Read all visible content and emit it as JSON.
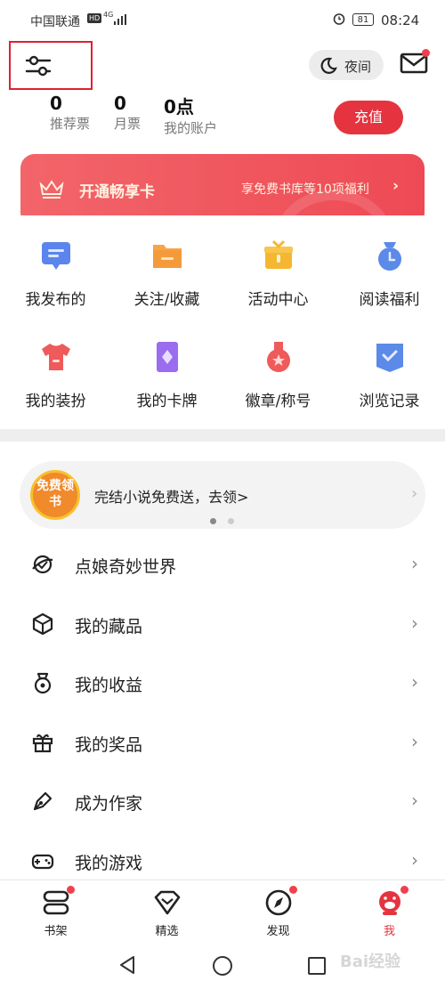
{
  "status_bar": {
    "carrier": "中国联通",
    "hd": "HD",
    "network": "4G",
    "battery": "81",
    "time": "08:24"
  },
  "header": {
    "night_label": "夜间"
  },
  "account": {
    "items": [
      {
        "value": "0",
        "label": "推荐票"
      },
      {
        "value": "0",
        "label": "月票"
      },
      {
        "value": "0点",
        "label": "我的账户"
      }
    ],
    "recharge_label": "充值"
  },
  "vip": {
    "title": "开通畅享卡",
    "benefit": "享免费书库等10项福利"
  },
  "grid": {
    "row1": [
      {
        "label": "我发布的",
        "icon": "chat-icon",
        "color": "#4f7fe8"
      },
      {
        "label": "关注/收藏",
        "icon": "folder-icon",
        "color": "#f59a3a"
      },
      {
        "label": "活动中心",
        "icon": "gift-box-icon",
        "color": "#f5b731"
      },
      {
        "label": "阅读福利",
        "icon": "clock-bag-icon",
        "color": "#5b8ae8"
      }
    ],
    "row2": [
      {
        "label": "我的装扮",
        "icon": "tshirt-icon",
        "color": "#ef5a5a"
      },
      {
        "label": "我的卡牌",
        "icon": "card-icon",
        "color": "#9a6cf0"
      },
      {
        "label": "徽章/称号",
        "icon": "medal-icon",
        "color": "#ef5a5a"
      },
      {
        "label": "浏览记录",
        "icon": "history-icon",
        "color": "#5b8ae8"
      }
    ]
  },
  "promo": {
    "badge": "免费领书",
    "text": "完结小说免费送，去领>"
  },
  "menu": [
    {
      "label": "点娘奇妙世界"
    },
    {
      "label": "我的藏品"
    },
    {
      "label": "我的收益"
    },
    {
      "label": "我的奖品"
    },
    {
      "label": "成为作家"
    },
    {
      "label": "我的游戏"
    }
  ],
  "tabs": [
    {
      "label": "书架"
    },
    {
      "label": "精选"
    },
    {
      "label": "发现"
    },
    {
      "label": "我"
    }
  ],
  "colors": {
    "accent": "#e53340",
    "tab_active": "#e53340"
  },
  "watermark": "Bai经验"
}
